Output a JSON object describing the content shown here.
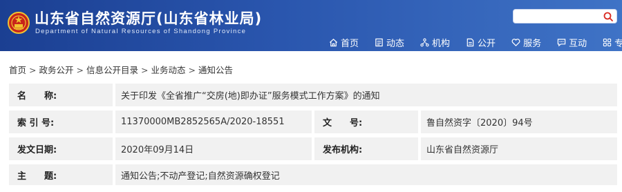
{
  "header": {
    "title": "山东省自然资源厅(山东省林业局)",
    "subtitle": "Department of Natural Resources of Shandong Province",
    "search_placeholder": "",
    "colors": {
      "bar_start": "#1b3f92",
      "bar_end": "#3f73c6",
      "emblem": "#c8241b"
    },
    "nav": [
      {
        "label": "首页",
        "icon": "home-icon"
      },
      {
        "label": "动态",
        "icon": "news-icon"
      },
      {
        "label": "机构",
        "icon": "org-icon"
      },
      {
        "label": "公开",
        "icon": "disclosure-icon"
      },
      {
        "label": "服务",
        "icon": "heart-icon"
      },
      {
        "label": "互动",
        "icon": "chat-icon"
      },
      {
        "label": "专题",
        "icon": "grid-icon"
      }
    ]
  },
  "breadcrumb": {
    "items": [
      "首页",
      "政务公开",
      "信息公开目录",
      "业务动态",
      "通知公告"
    ],
    "separator": ">"
  },
  "info": {
    "name_label": "名　　称:",
    "name_value": "关于印发《全省推广“交房(地)即办证”服务模式工作方案》的通知",
    "index_label": "索 引 号:",
    "index_value": "11370000MB2852565A/2020-18551",
    "docno_label": "文　　号:",
    "docno_value": "鲁自然资字〔2020〕94号",
    "date_label": "发文日期:",
    "date_value": "2020年09月14日",
    "issuer_label": "发布机构:",
    "issuer_value": "山东省自然资源厅",
    "topic_label": "主　　题:",
    "topic_value": "通知公告;不动产登记;自然资源确权登记"
  }
}
